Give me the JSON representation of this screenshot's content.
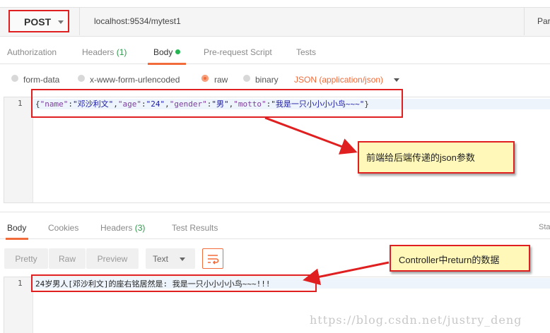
{
  "request": {
    "method": "POST",
    "url": "localhost:9534/mytest1",
    "params_label": "Par"
  },
  "request_tabs": [
    {
      "label": "Authorization"
    },
    {
      "label": "Headers",
      "count": "(1)"
    },
    {
      "label": "Body",
      "active": true
    },
    {
      "label": "Pre-request Script"
    },
    {
      "label": "Tests"
    }
  ],
  "body_types": {
    "form_data": "form-data",
    "urlencoded": "x-www-form-urlencoded",
    "raw": "raw",
    "binary": "binary",
    "content_type": "JSON (application/json)"
  },
  "request_body": {
    "line_number": "1",
    "json": {
      "name_key": "\"name\"",
      "name_val": "\"邓沙利文\"",
      "age_key": "\"age\"",
      "age_val": "\"24\"",
      "gender_key": "\"gender\"",
      "gender_val": "\"男\"",
      "motto_key": "\"motto\"",
      "motto_val": "\"我是一只小小小小鸟~~~\""
    }
  },
  "annotations": {
    "request_note": "前端给后端传递的json参数",
    "response_note": "Controller中return的数据"
  },
  "response_tabs": {
    "body": "Body",
    "cookies": "Cookies",
    "headers": "Headers",
    "headers_count": "(3)",
    "test_results": "Test Results",
    "status": "Sta"
  },
  "response_format": {
    "pretty": "Pretty",
    "raw": "Raw",
    "preview": "Preview",
    "type": "Text"
  },
  "response_body": {
    "line_number": "1",
    "text": "24岁男人[邓沙利文]的座右铭居然是: 我是一只小小小小鸟~~~!!!"
  },
  "watermark": "https://blog.csdn.net/justry_deng",
  "colors": {
    "accent": "#f26b3a",
    "annotation_border": "#e02020",
    "annotation_fill": "#fff8b8",
    "count_green": "#2e9a4a"
  }
}
